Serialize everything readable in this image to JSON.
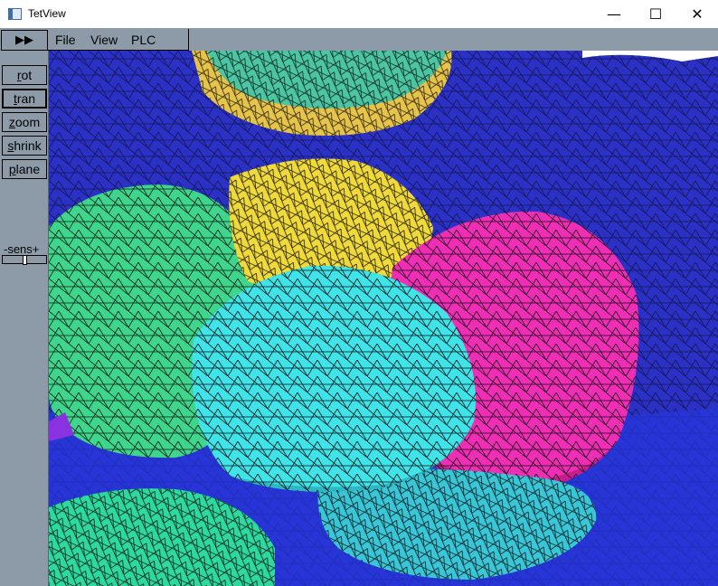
{
  "window": {
    "title": "TetView",
    "minimize_glyph": "—",
    "maximize_glyph": "☐",
    "close_glyph": "✕"
  },
  "menubar": {
    "play_glyph": "▶▶",
    "items": [
      "File",
      "View",
      "PLC"
    ]
  },
  "sidebar": {
    "buttons": [
      {
        "first": "r",
        "rest": "ot",
        "active": false
      },
      {
        "first": "t",
        "rest": "ran",
        "active": true
      },
      {
        "first": "z",
        "rest": "oom",
        "active": false
      },
      {
        "first": "s",
        "rest": "hrink",
        "active": false
      },
      {
        "first": "p",
        "rest": "lane",
        "active": false
      }
    ],
    "sens_label": "-sens+"
  },
  "viewport": {
    "background_color": "#2b31c4",
    "mesh_line_color": "#000000",
    "blob_colors": {
      "top_blob_yellow": "#e6c34a",
      "top_blob_teal": "#4bc5a2",
      "left_green": "#3fd58c",
      "center_yellow": "#f0d93a",
      "magenta": "#ee2fb5",
      "cyan": "#3fe3e8",
      "lower_cyan": "#39c7d8",
      "bottom_left_green": "#2ed9a0",
      "purple": "#8a32e0"
    }
  }
}
